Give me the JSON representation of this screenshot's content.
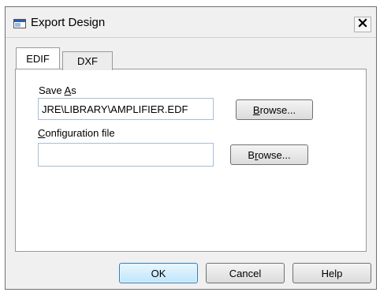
{
  "window": {
    "title": "Export Design",
    "close_glyph": "✕"
  },
  "tabs": [
    {
      "label": "EDIF",
      "active": true
    },
    {
      "label": "DXF",
      "active": false
    }
  ],
  "save_as": {
    "label_prefix": "Save ",
    "label_mnemonic": "A",
    "label_suffix": "s",
    "value": "JRE\\LIBRARY\\AMPLIFIER.EDF",
    "browse_mnemonic": "B",
    "browse_rest": "rowse..."
  },
  "config": {
    "label_mnemonic": "C",
    "label_rest": "onfiguration file",
    "value": "",
    "browse_prefix": "B",
    "browse_mnemonic": "r",
    "browse_rest": "owse..."
  },
  "buttons": {
    "ok": "OK",
    "cancel": "Cancel",
    "help": "Help"
  },
  "icons": {
    "app": "window-icon",
    "close": "close-icon"
  }
}
